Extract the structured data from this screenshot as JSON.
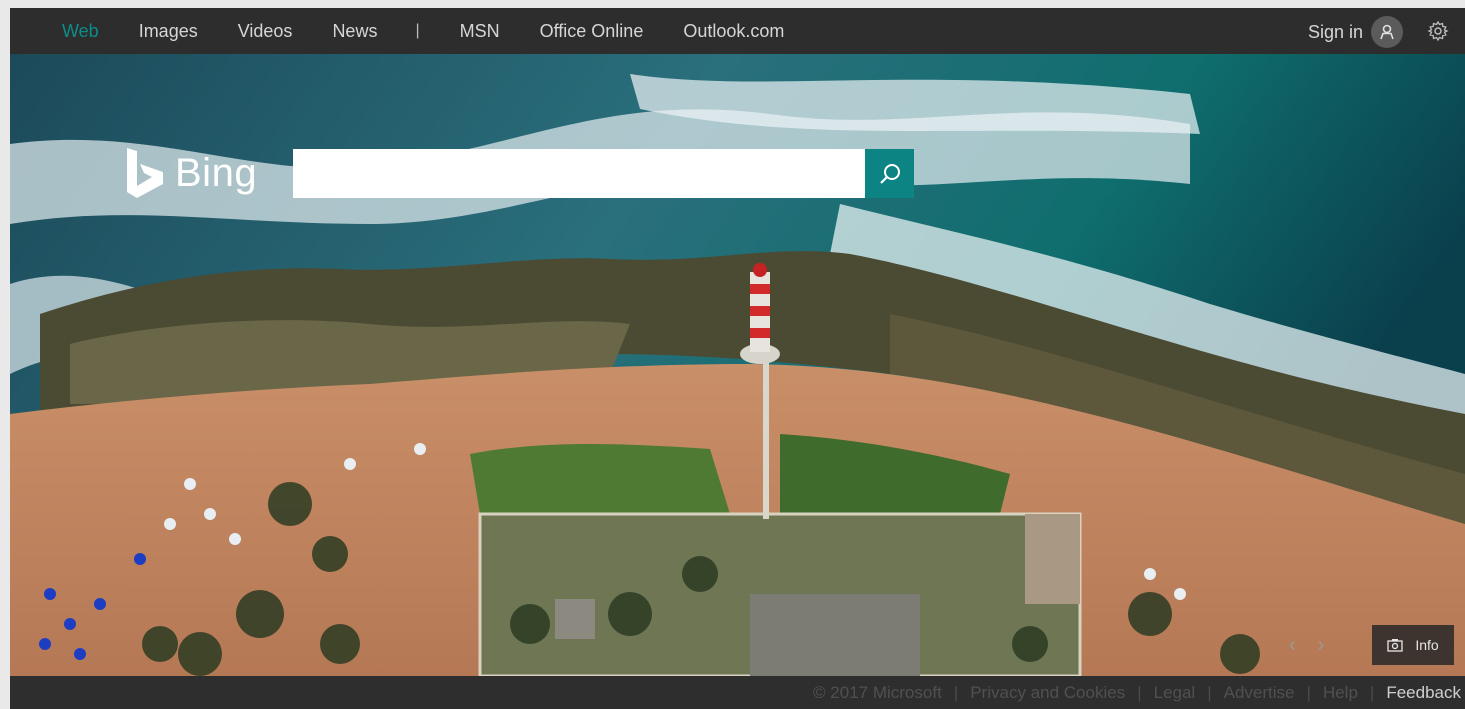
{
  "nav": {
    "items": [
      {
        "label": "Web",
        "active": true
      },
      {
        "label": "Images"
      },
      {
        "label": "Videos"
      },
      {
        "label": "News"
      },
      {
        "label": "MSN"
      },
      {
        "label": "Office Online"
      },
      {
        "label": "Outlook.com"
      }
    ],
    "separator": "|",
    "sign_in": "Sign in"
  },
  "logo": {
    "text": "Bing"
  },
  "search": {
    "value": "",
    "placeholder": ""
  },
  "image_controls": {
    "prev": "‹",
    "next": "›",
    "info_label": "Info"
  },
  "footer": {
    "copyright": "© 2017 Microsoft",
    "links": [
      "Privacy and Cookies",
      "Legal",
      "Advertise",
      "Help",
      "Feedback"
    ],
    "separator": "|"
  },
  "colors": {
    "accent": "#0c8484",
    "active_nav": "#0a8e8a",
    "bar": "#2d2d2d"
  }
}
